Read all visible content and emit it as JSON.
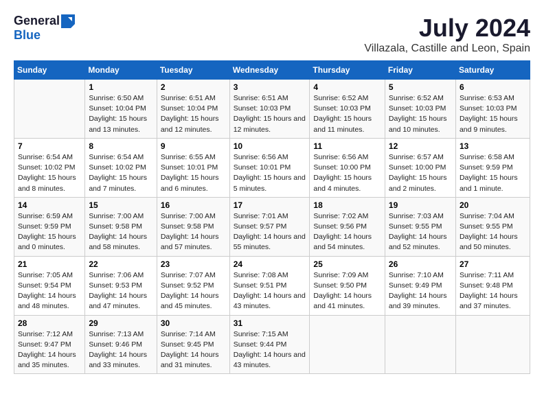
{
  "logo": {
    "general": "General",
    "blue": "Blue"
  },
  "title": "July 2024",
  "location": "Villazala, Castille and Leon, Spain",
  "days_header": [
    "Sunday",
    "Monday",
    "Tuesday",
    "Wednesday",
    "Thursday",
    "Friday",
    "Saturday"
  ],
  "weeks": [
    [
      {
        "day": "",
        "sunrise": "",
        "sunset": "",
        "daylight": ""
      },
      {
        "day": "1",
        "sunrise": "Sunrise: 6:50 AM",
        "sunset": "Sunset: 10:04 PM",
        "daylight": "Daylight: 15 hours and 13 minutes."
      },
      {
        "day": "2",
        "sunrise": "Sunrise: 6:51 AM",
        "sunset": "Sunset: 10:04 PM",
        "daylight": "Daylight: 15 hours and 12 minutes."
      },
      {
        "day": "3",
        "sunrise": "Sunrise: 6:51 AM",
        "sunset": "Sunset: 10:03 PM",
        "daylight": "Daylight: 15 hours and 12 minutes."
      },
      {
        "day": "4",
        "sunrise": "Sunrise: 6:52 AM",
        "sunset": "Sunset: 10:03 PM",
        "daylight": "Daylight: 15 hours and 11 minutes."
      },
      {
        "day": "5",
        "sunrise": "Sunrise: 6:52 AM",
        "sunset": "Sunset: 10:03 PM",
        "daylight": "Daylight: 15 hours and 10 minutes."
      },
      {
        "day": "6",
        "sunrise": "Sunrise: 6:53 AM",
        "sunset": "Sunset: 10:03 PM",
        "daylight": "Daylight: 15 hours and 9 minutes."
      }
    ],
    [
      {
        "day": "7",
        "sunrise": "Sunrise: 6:54 AM",
        "sunset": "Sunset: 10:02 PM",
        "daylight": "Daylight: 15 hours and 8 minutes."
      },
      {
        "day": "8",
        "sunrise": "Sunrise: 6:54 AM",
        "sunset": "Sunset: 10:02 PM",
        "daylight": "Daylight: 15 hours and 7 minutes."
      },
      {
        "day": "9",
        "sunrise": "Sunrise: 6:55 AM",
        "sunset": "Sunset: 10:01 PM",
        "daylight": "Daylight: 15 hours and 6 minutes."
      },
      {
        "day": "10",
        "sunrise": "Sunrise: 6:56 AM",
        "sunset": "Sunset: 10:01 PM",
        "daylight": "Daylight: 15 hours and 5 minutes."
      },
      {
        "day": "11",
        "sunrise": "Sunrise: 6:56 AM",
        "sunset": "Sunset: 10:00 PM",
        "daylight": "Daylight: 15 hours and 4 minutes."
      },
      {
        "day": "12",
        "sunrise": "Sunrise: 6:57 AM",
        "sunset": "Sunset: 10:00 PM",
        "daylight": "Daylight: 15 hours and 2 minutes."
      },
      {
        "day": "13",
        "sunrise": "Sunrise: 6:58 AM",
        "sunset": "Sunset: 9:59 PM",
        "daylight": "Daylight: 15 hours and 1 minute."
      }
    ],
    [
      {
        "day": "14",
        "sunrise": "Sunrise: 6:59 AM",
        "sunset": "Sunset: 9:59 PM",
        "daylight": "Daylight: 15 hours and 0 minutes."
      },
      {
        "day": "15",
        "sunrise": "Sunrise: 7:00 AM",
        "sunset": "Sunset: 9:58 PM",
        "daylight": "Daylight: 14 hours and 58 minutes."
      },
      {
        "day": "16",
        "sunrise": "Sunrise: 7:00 AM",
        "sunset": "Sunset: 9:58 PM",
        "daylight": "Daylight: 14 hours and 57 minutes."
      },
      {
        "day": "17",
        "sunrise": "Sunrise: 7:01 AM",
        "sunset": "Sunset: 9:57 PM",
        "daylight": "Daylight: 14 hours and 55 minutes."
      },
      {
        "day": "18",
        "sunrise": "Sunrise: 7:02 AM",
        "sunset": "Sunset: 9:56 PM",
        "daylight": "Daylight: 14 hours and 54 minutes."
      },
      {
        "day": "19",
        "sunrise": "Sunrise: 7:03 AM",
        "sunset": "Sunset: 9:55 PM",
        "daylight": "Daylight: 14 hours and 52 minutes."
      },
      {
        "day": "20",
        "sunrise": "Sunrise: 7:04 AM",
        "sunset": "Sunset: 9:55 PM",
        "daylight": "Daylight: 14 hours and 50 minutes."
      }
    ],
    [
      {
        "day": "21",
        "sunrise": "Sunrise: 7:05 AM",
        "sunset": "Sunset: 9:54 PM",
        "daylight": "Daylight: 14 hours and 48 minutes."
      },
      {
        "day": "22",
        "sunrise": "Sunrise: 7:06 AM",
        "sunset": "Sunset: 9:53 PM",
        "daylight": "Daylight: 14 hours and 47 minutes."
      },
      {
        "day": "23",
        "sunrise": "Sunrise: 7:07 AM",
        "sunset": "Sunset: 9:52 PM",
        "daylight": "Daylight: 14 hours and 45 minutes."
      },
      {
        "day": "24",
        "sunrise": "Sunrise: 7:08 AM",
        "sunset": "Sunset: 9:51 PM",
        "daylight": "Daylight: 14 hours and 43 minutes."
      },
      {
        "day": "25",
        "sunrise": "Sunrise: 7:09 AM",
        "sunset": "Sunset: 9:50 PM",
        "daylight": "Daylight: 14 hours and 41 minutes."
      },
      {
        "day": "26",
        "sunrise": "Sunrise: 7:10 AM",
        "sunset": "Sunset: 9:49 PM",
        "daylight": "Daylight: 14 hours and 39 minutes."
      },
      {
        "day": "27",
        "sunrise": "Sunrise: 7:11 AM",
        "sunset": "Sunset: 9:48 PM",
        "daylight": "Daylight: 14 hours and 37 minutes."
      }
    ],
    [
      {
        "day": "28",
        "sunrise": "Sunrise: 7:12 AM",
        "sunset": "Sunset: 9:47 PM",
        "daylight": "Daylight: 14 hours and 35 minutes."
      },
      {
        "day": "29",
        "sunrise": "Sunrise: 7:13 AM",
        "sunset": "Sunset: 9:46 PM",
        "daylight": "Daylight: 14 hours and 33 minutes."
      },
      {
        "day": "30",
        "sunrise": "Sunrise: 7:14 AM",
        "sunset": "Sunset: 9:45 PM",
        "daylight": "Daylight: 14 hours and 31 minutes."
      },
      {
        "day": "31",
        "sunrise": "Sunrise: 7:15 AM",
        "sunset": "Sunset: 9:44 PM",
        "daylight": "Daylight: 14 hours and 43 minutes."
      },
      {
        "day": "",
        "sunrise": "",
        "sunset": "",
        "daylight": ""
      },
      {
        "day": "",
        "sunrise": "",
        "sunset": "",
        "daylight": ""
      },
      {
        "day": "",
        "sunrise": "",
        "sunset": "",
        "daylight": ""
      }
    ]
  ]
}
